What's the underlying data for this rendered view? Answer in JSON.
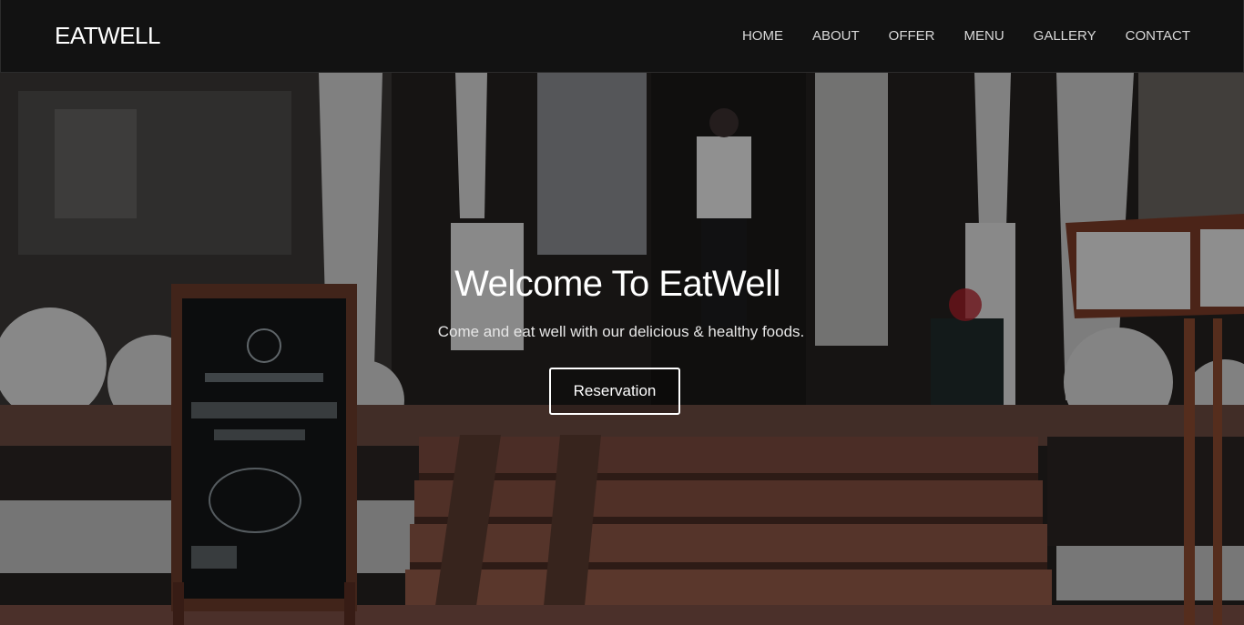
{
  "brand": "EATWELL",
  "nav": {
    "items": [
      {
        "label": "HOME"
      },
      {
        "label": "ABOUT"
      },
      {
        "label": "OFFER"
      },
      {
        "label": "MENU"
      },
      {
        "label": "GALLERY"
      },
      {
        "label": "CONTACT"
      }
    ]
  },
  "hero": {
    "title": "Welcome To EatWell",
    "subtitle": "Come and eat well with our delicious & healthy foods.",
    "button_label": "Reservation",
    "background_image": "restaurant-storefront-photo"
  },
  "colors": {
    "navbar_bg": "#121212",
    "text_primary": "#ffffff",
    "nav_text": "#d9d9d9"
  }
}
